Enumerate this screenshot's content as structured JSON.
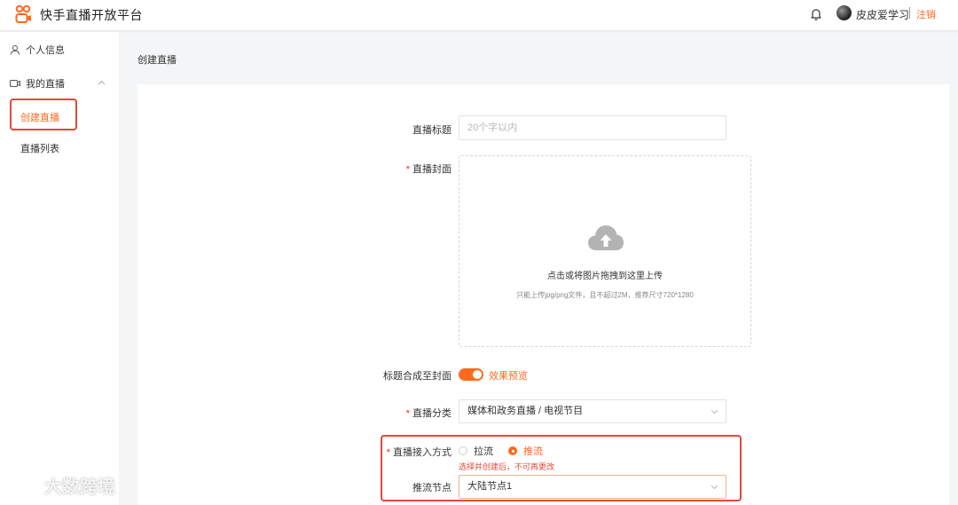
{
  "header": {
    "app_title": "快手直播开放平台",
    "logo_icon": "kuaishou-logo",
    "bell_icon": "bell-icon",
    "username": "皮皮爱学习",
    "logout": "注销",
    "accent": "#ff6a1f"
  },
  "sidebar": {
    "personal_info": "个人信息",
    "my_live": "我的直播",
    "sub_items": [
      {
        "label": "创建直播",
        "active": true
      },
      {
        "label": "直播列表",
        "active": false
      }
    ]
  },
  "breadcrumb": "创建直播",
  "form": {
    "title": {
      "label": "直播标题",
      "placeholder": "20个字以内",
      "value": ""
    },
    "cover": {
      "label": "直播封面",
      "required": "*",
      "hint": "点击或将图片拖拽到这里上传",
      "sub_hint": "只能上传jpg/png文件，且不超过2M，推荐尺寸720*1280"
    },
    "compose_title": {
      "label": "标题合成至封面",
      "enabled": true,
      "preview_link": "效果预览"
    },
    "category": {
      "label": "直播分类",
      "required": "*",
      "value": "媒体和政务直播 / 电视节目"
    },
    "access_mode": {
      "label": "直播接入方式",
      "required": "*",
      "options": [
        {
          "label": "拉流",
          "checked": false
        },
        {
          "label": "推流",
          "checked": true
        }
      ],
      "warning": "选择并创建后，不可再更改"
    },
    "push_node": {
      "label": "推流节点",
      "value": "大陆节点1"
    }
  },
  "watermark": {
    "text": "大数跨境"
  }
}
